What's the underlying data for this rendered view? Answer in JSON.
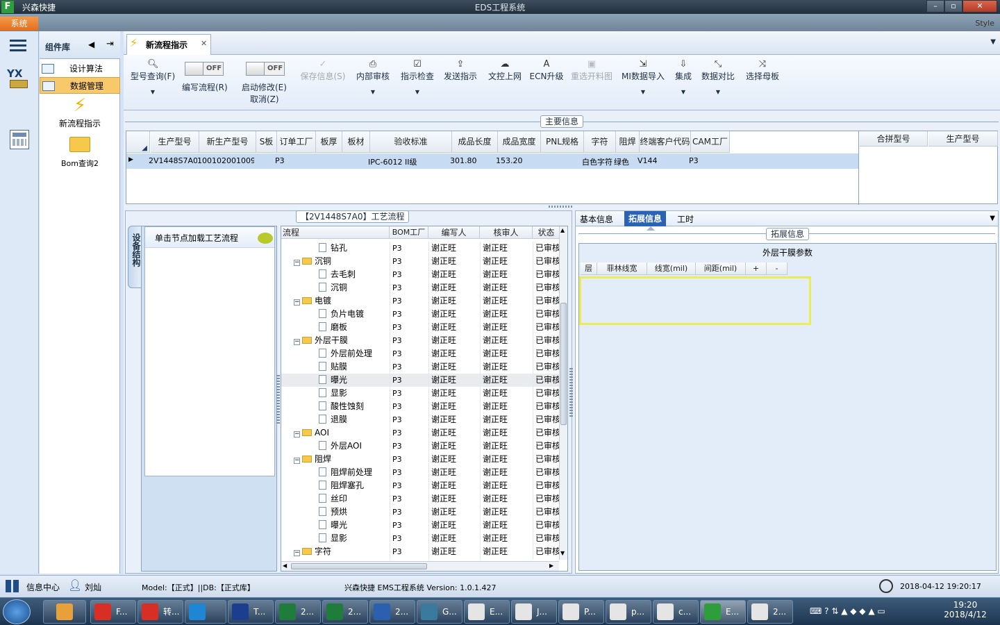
{
  "window": {
    "app_name": "兴森快捷",
    "title": "EDS工程系统"
  },
  "menu": {
    "system": "系统",
    "style": "Style"
  },
  "component_library": {
    "title": "组件库",
    "items": [
      {
        "label": "设计算法",
        "selected": false
      },
      {
        "label": "数据管理",
        "selected": true
      }
    ],
    "launchers": [
      {
        "label": "新流程指示",
        "icon": "lightning-icon"
      },
      {
        "label": "Bom查询2",
        "icon": "folder-icon"
      }
    ]
  },
  "doc_tab": {
    "label": "新流程指示"
  },
  "ribbon": {
    "model_query": "型号查询(F)",
    "toggle_off": "OFF",
    "edit_flow": "编写流程(R)",
    "start_modify": "启动修改(E)",
    "cancel": "取消(Z)",
    "save_info": "保存信息(S)",
    "internal_review": "内部审核",
    "instruction_check": "指示检查",
    "send_instruction": "发送指示",
    "doc_control_upload": "文控上网",
    "ecn_upgrade": "ECN升级",
    "reselect_cut": "重选开料图",
    "mi_import": "MI数据导入",
    "integrate": "集成",
    "data_compare": "数据对比",
    "select_master": "选择母板"
  },
  "main_info": {
    "title": "主要信息",
    "columns": [
      "生产型号",
      "新生产型号",
      "S板",
      "订单工厂",
      "板厚",
      "板材",
      "验收标准",
      "成品长度",
      "成品宽度",
      "PNL规格",
      "字符",
      "阻焊",
      "终端客户代码",
      "CAM工厂"
    ],
    "row": [
      "2V1448S7A0",
      "10010200100972",
      "",
      "P3",
      "",
      "",
      "IPC-6012 II级",
      "301.80",
      "153.20",
      "",
      "白色字符",
      "绿色",
      "V144",
      "P3"
    ],
    "side_columns": [
      "合拼型号",
      "生产型号"
    ]
  },
  "flow": {
    "title": "【2V1448S7A0】工艺流程",
    "side_tab": "设备结构",
    "hint": "单击节点加载工艺流程",
    "columns": [
      "流程",
      "BOM工厂",
      "编写人",
      "核审人",
      "状态"
    ],
    "rows": [
      {
        "name": "钻孔",
        "level": 2,
        "folder": false,
        "bom": "P3",
        "writer": "谢正旺",
        "reviewer": "谢正旺",
        "status": "已审核"
      },
      {
        "name": "沉铜",
        "level": 1,
        "folder": true,
        "bom": "P3",
        "writer": "谢正旺",
        "reviewer": "谢正旺",
        "status": "已审核"
      },
      {
        "name": "去毛刺",
        "level": 2,
        "folder": false,
        "bom": "P3",
        "writer": "谢正旺",
        "reviewer": "谢正旺",
        "status": "已审核"
      },
      {
        "name": "沉铜",
        "level": 2,
        "folder": false,
        "bom": "P3",
        "writer": "谢正旺",
        "reviewer": "谢正旺",
        "status": "已审核"
      },
      {
        "name": "电镀",
        "level": 1,
        "folder": true,
        "bom": "P3",
        "writer": "谢正旺",
        "reviewer": "谢正旺",
        "status": "已审核"
      },
      {
        "name": "负片电镀",
        "level": 2,
        "folder": false,
        "bom": "P3",
        "writer": "谢正旺",
        "reviewer": "谢正旺",
        "status": "已审核"
      },
      {
        "name": "磨板",
        "level": 2,
        "folder": false,
        "bom": "P3",
        "writer": "谢正旺",
        "reviewer": "谢正旺",
        "status": "已审核"
      },
      {
        "name": "外层干膜",
        "level": 1,
        "folder": true,
        "bom": "P3",
        "writer": "谢正旺",
        "reviewer": "谢正旺",
        "status": "已审核"
      },
      {
        "name": "外层前处理",
        "level": 2,
        "folder": false,
        "bom": "P3",
        "writer": "谢正旺",
        "reviewer": "谢正旺",
        "status": "已审核"
      },
      {
        "name": "贴膜",
        "level": 2,
        "folder": false,
        "bom": "P3",
        "writer": "谢正旺",
        "reviewer": "谢正旺",
        "status": "已审核"
      },
      {
        "name": "曝光",
        "level": 2,
        "folder": false,
        "bom": "P3",
        "writer": "谢正旺",
        "reviewer": "谢正旺",
        "status": "已审核",
        "selected": true
      },
      {
        "name": "显影",
        "level": 2,
        "folder": false,
        "bom": "P3",
        "writer": "谢正旺",
        "reviewer": "谢正旺",
        "status": "已审核"
      },
      {
        "name": "酸性蚀刻",
        "level": 2,
        "folder": false,
        "bom": "P3",
        "writer": "谢正旺",
        "reviewer": "谢正旺",
        "status": "已审核"
      },
      {
        "name": "退膜",
        "level": 2,
        "folder": false,
        "bom": "P3",
        "writer": "谢正旺",
        "reviewer": "谢正旺",
        "status": "已审核"
      },
      {
        "name": "AOI",
        "level": 1,
        "folder": true,
        "bom": "P3",
        "writer": "谢正旺",
        "reviewer": "谢正旺",
        "status": "已审核"
      },
      {
        "name": "外层AOI",
        "level": 2,
        "folder": false,
        "bom": "P3",
        "writer": "谢正旺",
        "reviewer": "谢正旺",
        "status": "已审核"
      },
      {
        "name": "阻焊",
        "level": 1,
        "folder": true,
        "bom": "P3",
        "writer": "谢正旺",
        "reviewer": "谢正旺",
        "status": "已审核"
      },
      {
        "name": "阻焊前处理",
        "level": 2,
        "folder": false,
        "bom": "P3",
        "writer": "谢正旺",
        "reviewer": "谢正旺",
        "status": "已审核"
      },
      {
        "name": "阻焊塞孔",
        "level": 2,
        "folder": false,
        "bom": "P3",
        "writer": "谢正旺",
        "reviewer": "谢正旺",
        "status": "已审核"
      },
      {
        "name": "丝印",
        "level": 2,
        "folder": false,
        "bom": "P3",
        "writer": "谢正旺",
        "reviewer": "谢正旺",
        "status": "已审核"
      },
      {
        "name": "预烘",
        "level": 2,
        "folder": false,
        "bom": "P3",
        "writer": "谢正旺",
        "reviewer": "谢正旺",
        "status": "已审核"
      },
      {
        "name": "曝光",
        "level": 2,
        "folder": false,
        "bom": "P3",
        "writer": "谢正旺",
        "reviewer": "谢正旺",
        "status": "已审核"
      },
      {
        "name": "显影",
        "level": 2,
        "folder": false,
        "bom": "P3",
        "writer": "谢正旺",
        "reviewer": "谢正旺",
        "status": "已审核"
      },
      {
        "name": "字符",
        "level": 1,
        "folder": true,
        "bom": "P3",
        "writer": "谢正旺",
        "reviewer": "谢正旺",
        "status": "已审核"
      }
    ]
  },
  "detail": {
    "tabs": [
      {
        "label": "基本信息",
        "active": false
      },
      {
        "label": "拓展信息",
        "active": true
      },
      {
        "label": "工时",
        "active": false
      }
    ],
    "group_title": "拓展信息",
    "param_title": "外层干膜参数",
    "param_columns": [
      "层",
      "菲林线宽",
      "线宽(mil)",
      "间距(mil)",
      "+",
      "-"
    ]
  },
  "status": {
    "info_center": "信息中心",
    "user": "刘灿",
    "model": "Model:【正式】||DB:【正式库】",
    "system": "兴森快捷 EMS工程系统 Version: 1.0.1.427",
    "datetime": "2018-04-12 19:20:17"
  },
  "taskbar": {
    "items": [
      "F...",
      "转...",
      "",
      "T...",
      "2...",
      "2...",
      "2...",
      "G...",
      "E...",
      "J...",
      "P...",
      "p...",
      "c...",
      "E...",
      "2..."
    ],
    "time": "19:20",
    "date": "2018/4/12"
  }
}
